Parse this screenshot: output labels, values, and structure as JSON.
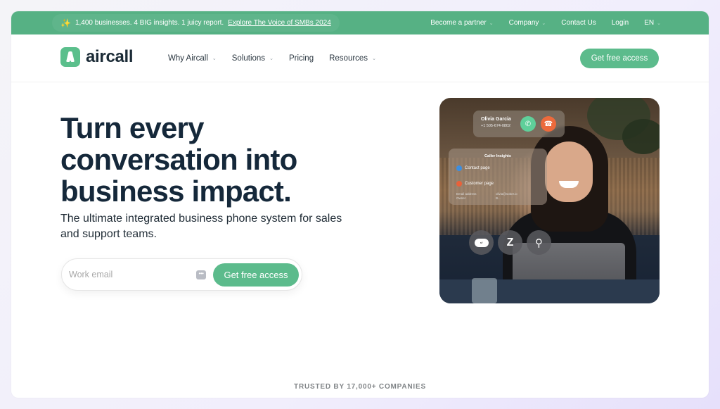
{
  "announcement": {
    "icon": "sparkle-icon",
    "text": "1,400 businesses. 4 BIG insights. 1 juicy report.",
    "link": "Explore The Voice of SMBs 2024"
  },
  "top_links": [
    {
      "label": "Become a partner",
      "dropdown": true
    },
    {
      "label": "Company",
      "dropdown": true
    },
    {
      "label": "Contact Us",
      "dropdown": false
    },
    {
      "label": "Login",
      "dropdown": false
    },
    {
      "label": "EN",
      "dropdown": true
    }
  ],
  "brand": {
    "name": "aircall",
    "color": "#5cbb8c"
  },
  "nav": {
    "items": [
      {
        "label": "Why Aircall",
        "dropdown": true
      },
      {
        "label": "Solutions",
        "dropdown": true
      },
      {
        "label": "Pricing",
        "dropdown": false
      },
      {
        "label": "Resources",
        "dropdown": true
      }
    ],
    "cta": "Get free access"
  },
  "hero": {
    "title": "Turn every conversation into business impact.",
    "subtitle": "The ultimate integrated business phone system for sales and support teams.",
    "email_placeholder": "Work email",
    "email_value": "",
    "cta": "Get free access"
  },
  "photo_overlay": {
    "caller_name": "Olivia Garcia",
    "caller_phone": "+1 505-674-0802",
    "insights_title": "Caller Insights",
    "insights_rows": [
      "Contact page",
      "Customer page"
    ],
    "meta_labels": [
      "Email address",
      "Owner"
    ],
    "meta_values": [
      "olivia@sober.io",
      "B..."
    ],
    "integrations": [
      "salesforce",
      "zendesk",
      "hubspot"
    ]
  },
  "trusted": "TRUSTED BY 17,000+ COMPANIES"
}
